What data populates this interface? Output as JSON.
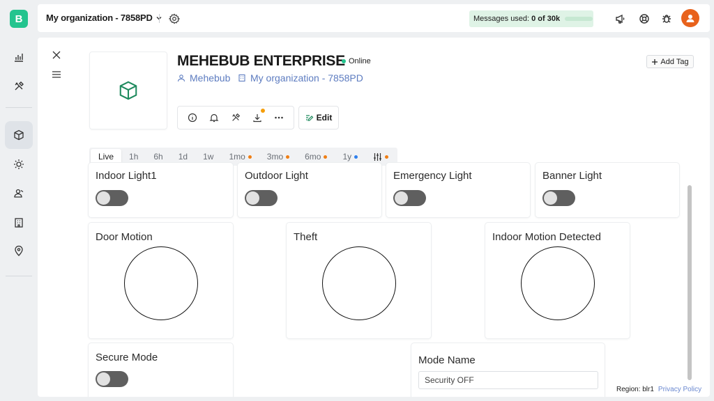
{
  "app": {
    "logo_letter": "B",
    "accent": "#23c48e"
  },
  "sidebar": {
    "items": [
      {
        "icon": "chart-icon"
      },
      {
        "icon": "tools-icon"
      },
      {
        "icon": "cube-icon",
        "active": true
      },
      {
        "icon": "sun-icon"
      },
      {
        "icon": "users-icon"
      },
      {
        "icon": "building-icon"
      },
      {
        "icon": "location-pin-icon"
      }
    ]
  },
  "header": {
    "org_label": "My organization - 7858PD",
    "messages_label": "Messages used:",
    "messages_value": "0 of 30k",
    "icons": [
      "megaphone-icon",
      "lifebuoy-icon",
      "bug-icon",
      "user-avatar-icon"
    ]
  },
  "device": {
    "name": "MEHEBUB ENTERPRISE",
    "status": "Online",
    "owner": "Mehebub",
    "org": "My organization - 7858PD",
    "edit_label": "Edit",
    "add_tag_label": "Add Tag",
    "actions": [
      "info-icon",
      "bell-icon",
      "tools-icon",
      "download-icon",
      "more-icon"
    ]
  },
  "time_tabs": [
    {
      "label": "Live",
      "active": true
    },
    {
      "label": "1h"
    },
    {
      "label": "6h"
    },
    {
      "label": "1d"
    },
    {
      "label": "1w"
    },
    {
      "label": "1mo",
      "dot": "#f07f14"
    },
    {
      "label": "3mo",
      "dot": "#f07f14"
    },
    {
      "label": "6mo",
      "dot": "#f07f14"
    },
    {
      "label": "1y",
      "dot": "#2f80ed"
    }
  ],
  "widgets": {
    "indoor_light": {
      "label": "Indoor Light1",
      "on": false
    },
    "outdoor_light": {
      "label": "Outdoor Light",
      "on": false
    },
    "emergency_light": {
      "label": "Emergency Light",
      "on": false
    },
    "banner_light": {
      "label": "Banner Light",
      "on": false
    },
    "door_motion": {
      "label": "Door Motion"
    },
    "theft": {
      "label": "Theft"
    },
    "indoor_motion": {
      "label": "Indoor Motion Detected"
    },
    "secure_mode": {
      "label": "Secure Mode",
      "on": false
    },
    "mode_name": {
      "label": "Mode Name",
      "value": "Security OFF"
    }
  },
  "footer": {
    "region": "Region: blr1",
    "privacy": "Privacy Policy"
  }
}
